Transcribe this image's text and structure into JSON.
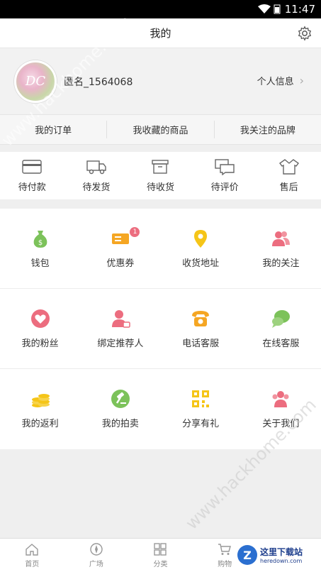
{
  "status_bar": {
    "time": "11:47"
  },
  "header": {
    "title": "我的"
  },
  "profile": {
    "avatar_text": "DC",
    "username": "匿名_1564068",
    "info_link": "个人信息"
  },
  "quick_tabs": [
    "我的订单",
    "我收藏的商品",
    "我关注的品牌"
  ],
  "orders": [
    {
      "label": "待付款",
      "icon": "card-icon"
    },
    {
      "label": "待发货",
      "icon": "truck-icon"
    },
    {
      "label": "待收货",
      "icon": "box-icon"
    },
    {
      "label": "待评价",
      "icon": "comment-icon"
    },
    {
      "label": "售后",
      "icon": "shirt-icon"
    }
  ],
  "grid": [
    [
      {
        "label": "钱包",
        "icon": "money-bag-icon",
        "color": "#7cc25a"
      },
      {
        "label": "优惠券",
        "icon": "coupon-icon",
        "color": "#f5a623",
        "badge": "1"
      },
      {
        "label": "收货地址",
        "icon": "location-pin-icon",
        "color": "#f5c518"
      },
      {
        "label": "我的关注",
        "icon": "people-icon",
        "color": "#ec6d7f"
      }
    ],
    [
      {
        "label": "我的粉丝",
        "icon": "heart-icon",
        "color": "#ec6d7f"
      },
      {
        "label": "绑定推荐人",
        "icon": "user-link-icon",
        "color": "#ec6d7f"
      },
      {
        "label": "电话客服",
        "icon": "phone-icon",
        "color": "#f5a623"
      },
      {
        "label": "在线客服",
        "icon": "chat-icon",
        "color": "#7cc25a"
      }
    ],
    [
      {
        "label": "我的返利",
        "icon": "coins-icon",
        "color": "#f5c518"
      },
      {
        "label": "我的拍卖",
        "icon": "gavel-icon",
        "color": "#7cc25a"
      },
      {
        "label": "分享有礼",
        "icon": "qr-code-icon",
        "color": "#f5c518"
      },
      {
        "label": "关于我们",
        "icon": "group-icon",
        "color": "#ec6d7f"
      }
    ]
  ],
  "bottom_nav": [
    "首页",
    "广场",
    "分类",
    "购物"
  ],
  "watermarks": {
    "site": "www.hackhome.com",
    "logo_title": "这里下载站",
    "logo_sub": "heredown.com",
    "logo_letter": "Z"
  }
}
